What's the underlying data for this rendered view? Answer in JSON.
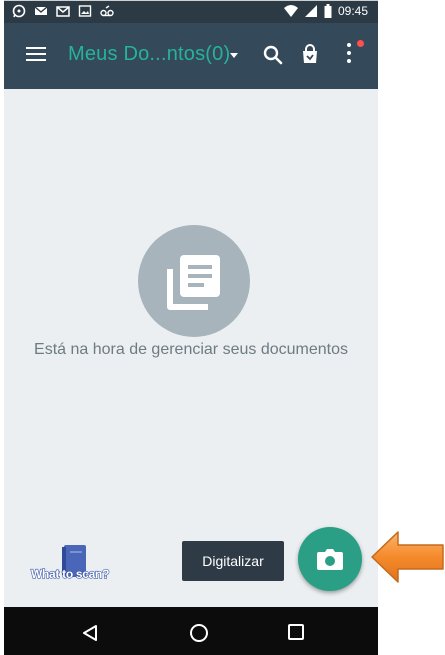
{
  "status_bar": {
    "time": "09:45",
    "left_icons": [
      "whatsapp-icon",
      "email-icon",
      "gmail-icon",
      "image-icon",
      "voicemail-icon"
    ],
    "right_icons": [
      "wifi-icon",
      "signal-icon",
      "battery-icon"
    ]
  },
  "toolbar": {
    "title": "Meus Do...ntos(0)",
    "icons": [
      "menu-icon",
      "dropdown-icon",
      "search-icon",
      "shopping-bag-icon",
      "more-vert-icon"
    ],
    "notification_dot_color": "#ff4f4f",
    "background_color": "#34495a",
    "title_color": "#26b39a"
  },
  "empty_state": {
    "icon": "documents-icon",
    "message": "Está na hora de gerenciar seus documentos"
  },
  "tooltip": {
    "label": "Digitalizar"
  },
  "fab": {
    "icon": "camera-icon",
    "color": "#2a9f86"
  },
  "what_to_scan": {
    "label": "What to scan?",
    "icon": "book-icon"
  },
  "nav_bar": {
    "icons": [
      "back-icon",
      "home-icon",
      "recents-icon"
    ]
  },
  "annotation": {
    "icon": "arrow-left-icon",
    "color": "#f58a2b"
  }
}
